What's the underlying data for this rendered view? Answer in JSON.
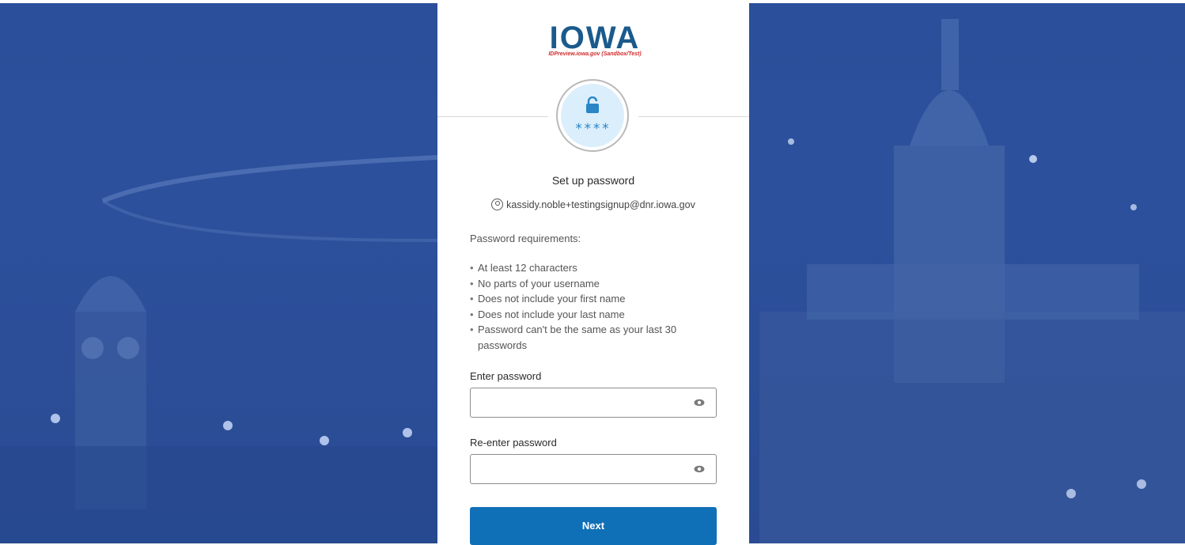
{
  "logo": {
    "text": "IOWA",
    "subtitle": "IDPreview.iowa.gov (Sandbox/Test)"
  },
  "badge": {
    "icon": "lock-open-icon",
    "stars": "****"
  },
  "header": {
    "title": "Set up password"
  },
  "user": {
    "icon": "user-circle-icon",
    "email": "kassidy.noble+testingsignup@dnr.iowa.gov"
  },
  "requirements": {
    "heading": "Password requirements:",
    "items": [
      "At least 12 characters",
      "No parts of your username",
      "Does not include your first name",
      "Does not include your last name",
      "Password can't be the same as your last 30 passwords"
    ]
  },
  "fields": {
    "password": {
      "label": "Enter password",
      "value": "",
      "icon": "eye-icon"
    },
    "confirm": {
      "label": "Re-enter password",
      "value": "",
      "icon": "eye-icon"
    }
  },
  "actions": {
    "next_label": "Next"
  },
  "colors": {
    "accent": "#1070b7",
    "background": "#2d509c",
    "badge_fill": "#dbeefb",
    "logo_blue": "#1a5a8c"
  }
}
